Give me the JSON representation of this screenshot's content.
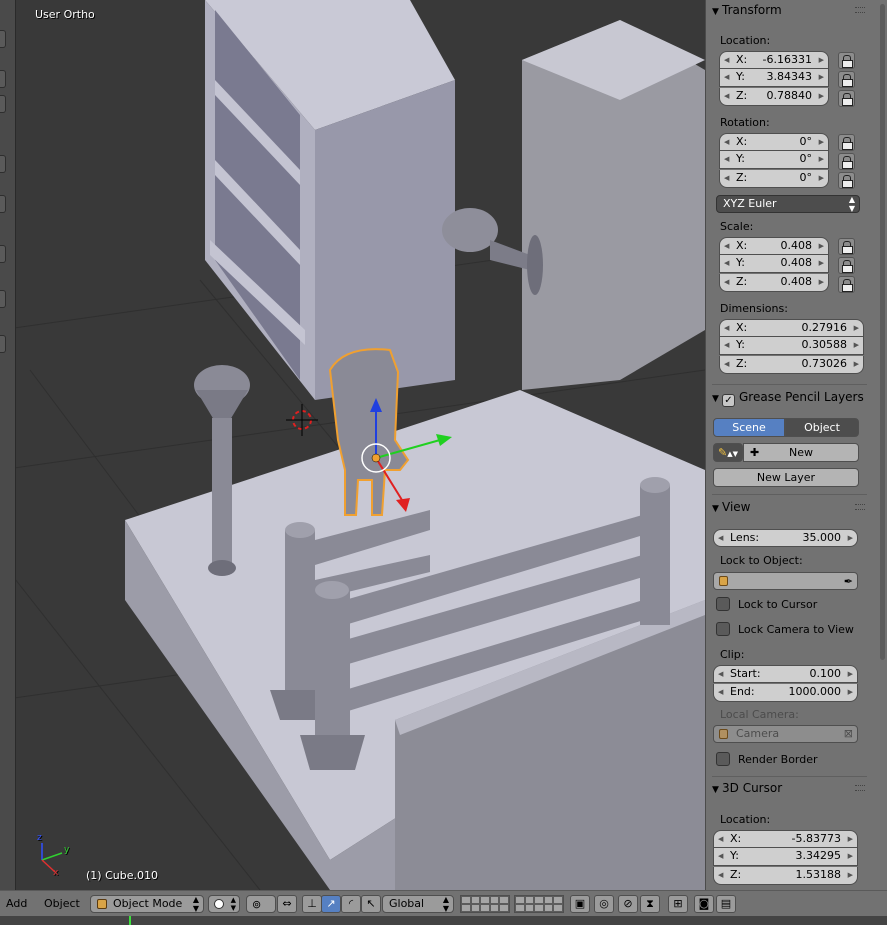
{
  "viewport": {
    "view_label": "User Ortho",
    "object_label": "(1) Cube.010",
    "axis_labels": {
      "x": "x",
      "y": "y",
      "z": "z"
    }
  },
  "panel": {
    "transform": {
      "title": "Transform",
      "location_label": "Location:",
      "location": [
        {
          "axis": "X:",
          "value": "-6.16331"
        },
        {
          "axis": "Y:",
          "value": "3.84343"
        },
        {
          "axis": "Z:",
          "value": "0.78840"
        }
      ],
      "rotation_label": "Rotation:",
      "rotation": [
        {
          "axis": "X:",
          "value": "0°"
        },
        {
          "axis": "Y:",
          "value": "0°"
        },
        {
          "axis": "Z:",
          "value": "0°"
        }
      ],
      "rotation_mode": "XYZ Euler",
      "scale_label": "Scale:",
      "scale": [
        {
          "axis": "X:",
          "value": "0.408"
        },
        {
          "axis": "Y:",
          "value": "0.408"
        },
        {
          "axis": "Z:",
          "value": "0.408"
        }
      ],
      "dimensions_label": "Dimensions:",
      "dimensions": [
        {
          "axis": "X:",
          "value": "0.27916"
        },
        {
          "axis": "Y:",
          "value": "0.30588"
        },
        {
          "axis": "Z:",
          "value": "0.73026"
        }
      ]
    },
    "grease_pencil": {
      "title": "Grease Pencil Layers",
      "tabs": [
        "Scene",
        "Object"
      ],
      "active_tab": "Scene",
      "new_label": "New",
      "new_layer_label": "New Layer"
    },
    "view": {
      "title": "View",
      "lens_label": "Lens:",
      "lens_value": "35.000",
      "lock_to_object_label": "Lock to Object:",
      "lock_to_cursor_label": "Lock to Cursor",
      "lock_camera_label": "Lock Camera to View",
      "clip_label": "Clip:",
      "clip_start_label": "Start:",
      "clip_start_value": "0.100",
      "clip_end_label": "End:",
      "clip_end_value": "1000.000",
      "local_camera_label": "Local Camera:",
      "local_camera_value": "Camera",
      "render_border_label": "Render Border"
    },
    "cursor": {
      "title": "3D Cursor",
      "location_label": "Location:",
      "location": [
        {
          "axis": "X:",
          "value": "-5.83773"
        },
        {
          "axis": "Y:",
          "value": "3.34295"
        },
        {
          "axis": "Z:",
          "value": "1.53188"
        }
      ]
    }
  },
  "header": {
    "add_label": "Add",
    "object_label": "Object",
    "mode_value": "Object Mode",
    "orientation_value": "Global"
  },
  "colors": {
    "selection_outline": "#f0a030",
    "gizmo_x": "#e02020",
    "gizmo_y": "#20d020",
    "gizmo_z": "#2040e0",
    "active_button": "#5680c2"
  }
}
